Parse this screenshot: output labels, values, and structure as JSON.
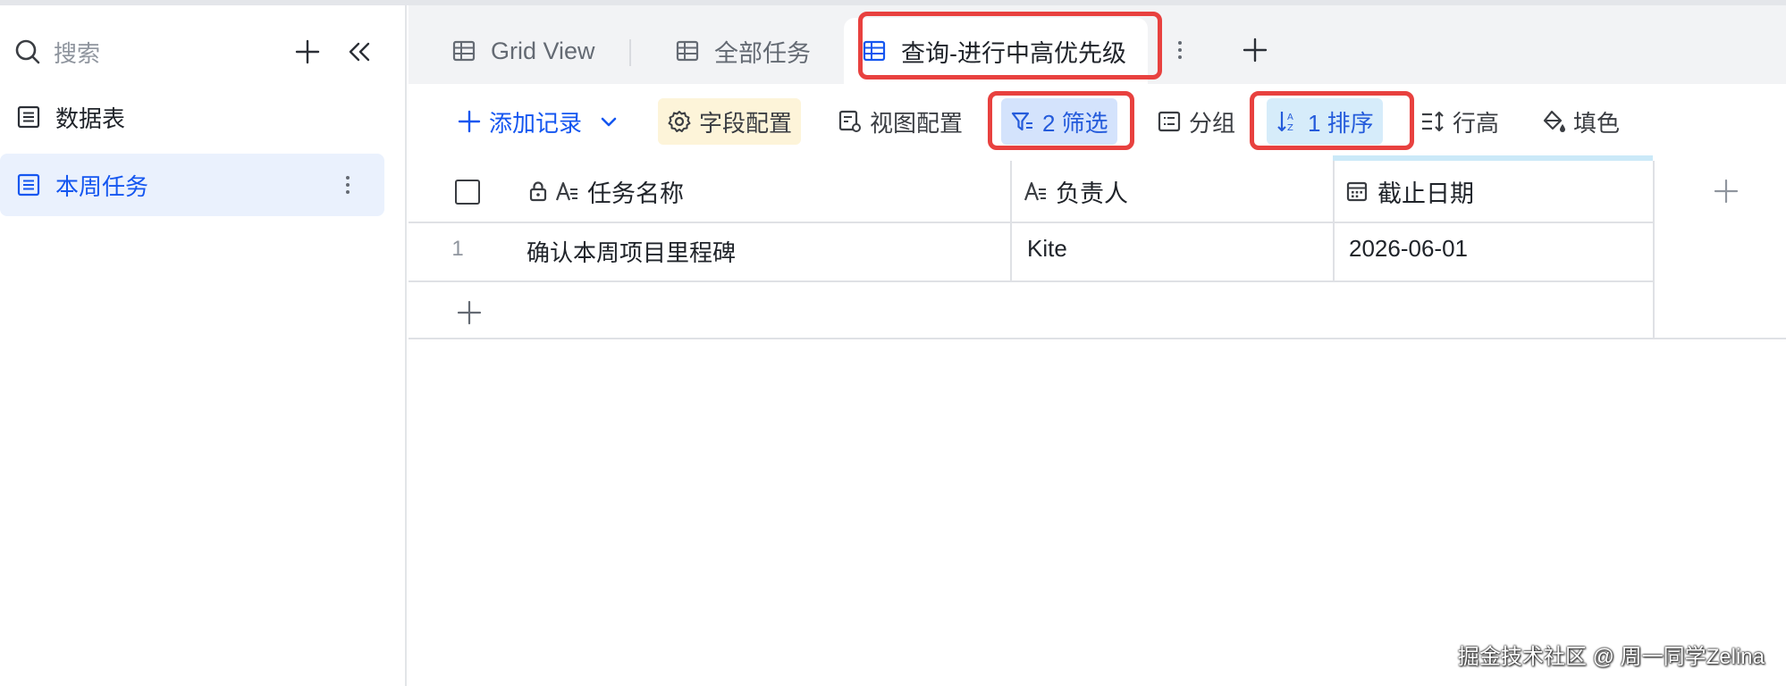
{
  "sidebar": {
    "search_placeholder": "搜索",
    "items": [
      {
        "label": "数据表",
        "active": false
      },
      {
        "label": "本周任务",
        "active": true
      }
    ]
  },
  "tabs": [
    {
      "label": "Grid View",
      "active": false
    },
    {
      "label": "全部任务",
      "active": false
    },
    {
      "label": "查询-进行中高优先级",
      "active": true
    }
  ],
  "toolbar": {
    "add_record": "添加记录",
    "field_config": "字段配置",
    "view_config": "视图配置",
    "filter": "2 筛选",
    "group": "分组",
    "sort": "1 排序",
    "row_height": "行高",
    "fill_color": "填色"
  },
  "grid": {
    "columns": [
      {
        "label": "任务名称",
        "type": "text",
        "locked": true
      },
      {
        "label": "负责人",
        "type": "text"
      },
      {
        "label": "截止日期",
        "type": "date"
      }
    ],
    "rows": [
      {
        "index": "1",
        "cells": [
          "确认本周项目里程碑",
          "Kite",
          "2026-06-01"
        ]
      }
    ]
  },
  "watermark": "掘金技术社区 @ 周一同学Zelina",
  "colors": {
    "accent": "#1456f0",
    "highlight": "#e8413f",
    "active_nav_bg": "#eaf1fd",
    "filter_bg": "#d4e3fc",
    "sort_bg": "#d6ecfa",
    "field_config_bg": "#fdf4d9"
  },
  "icons": {
    "table": "grid-table-icon",
    "search": "search-icon",
    "plus": "plus-icon",
    "collapse": "double-chevron-left-icon",
    "more": "vertical-dots-icon"
  }
}
